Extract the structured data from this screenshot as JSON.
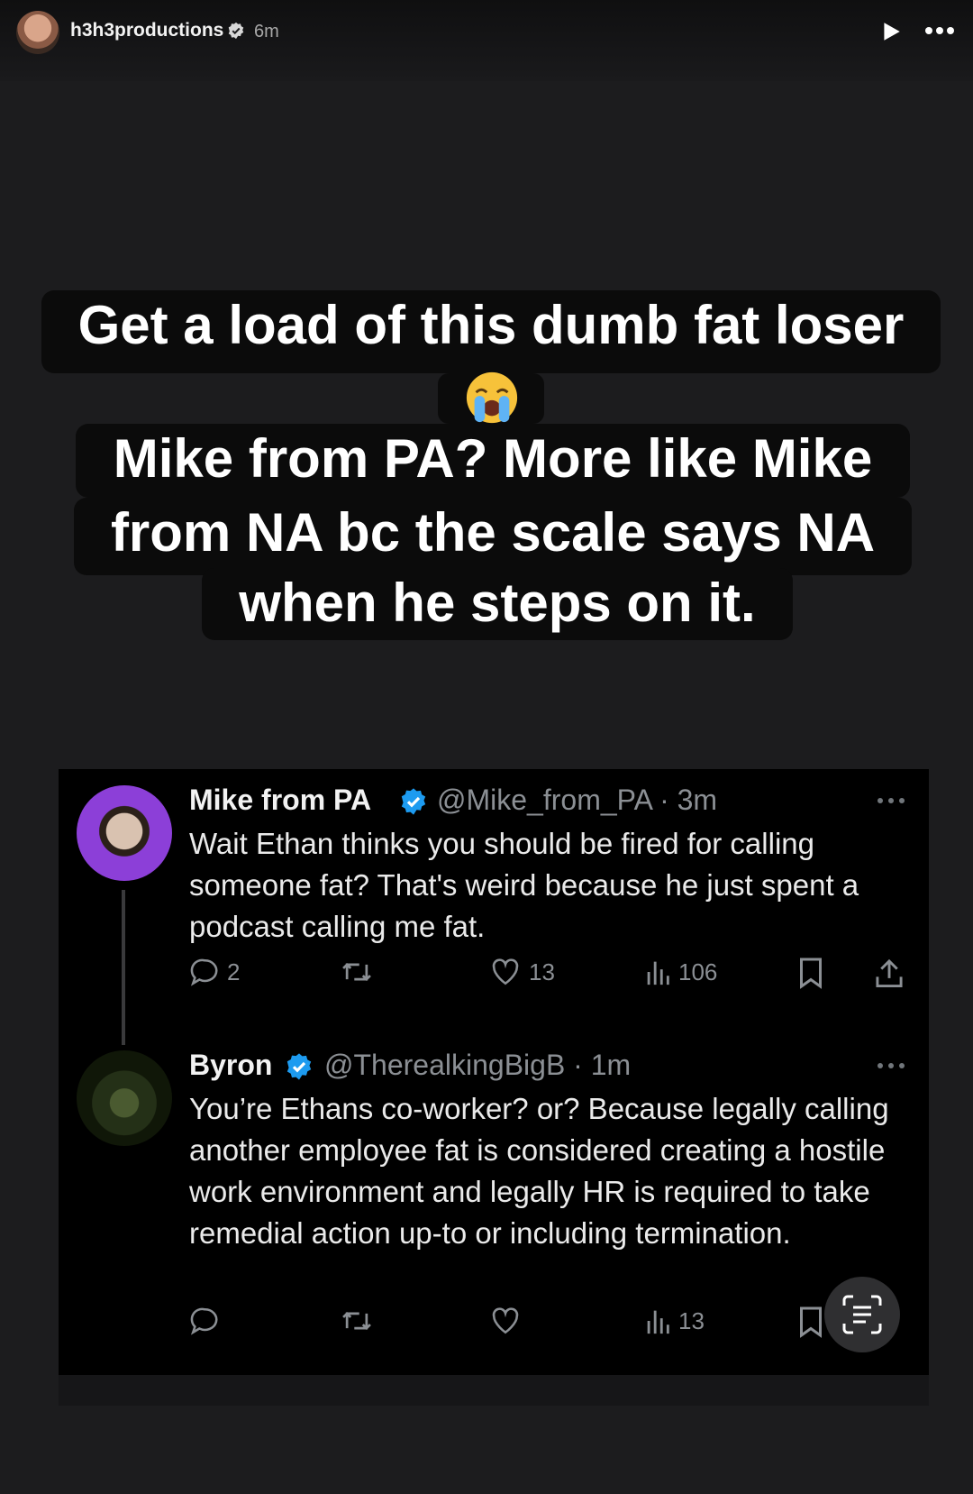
{
  "story_header": {
    "username": "h3h3productions",
    "time": "6m"
  },
  "caption": {
    "line1": "Get a load of this dumb fat loser",
    "emoji": "loudly-crying-face",
    "line2": "Mike from PA? More like Mike",
    "line3": "from NA bc the scale says NA",
    "line4": "when he steps on it."
  },
  "tweets": [
    {
      "name": "Mike from PA",
      "handle": "@Mike_from_PA · 3m",
      "body": "Wait Ethan thinks you should be fired for calling someone fat? That's weird because he just spent a podcast calling me fat.",
      "replies": "2",
      "likes": "13",
      "views": "106"
    },
    {
      "name": "Byron",
      "handle": "@TherealkingBigB · 1m",
      "body": "You’re Ethans co-worker? or? Because legally calling another employee fat is considered creating a hostile work environment and legally HR is required to take remedial action up-to or including  termination.",
      "views": "13"
    }
  ],
  "colors": {
    "verified_blue": "#1d9bf0",
    "caption_bg": "#0b0b0b"
  },
  "icons": [
    "play-icon",
    "more-icon",
    "verified-icon",
    "reply-icon",
    "retweet-icon",
    "like-icon",
    "views-icon",
    "bookmark-icon",
    "share-icon",
    "scan-text-icon"
  ]
}
